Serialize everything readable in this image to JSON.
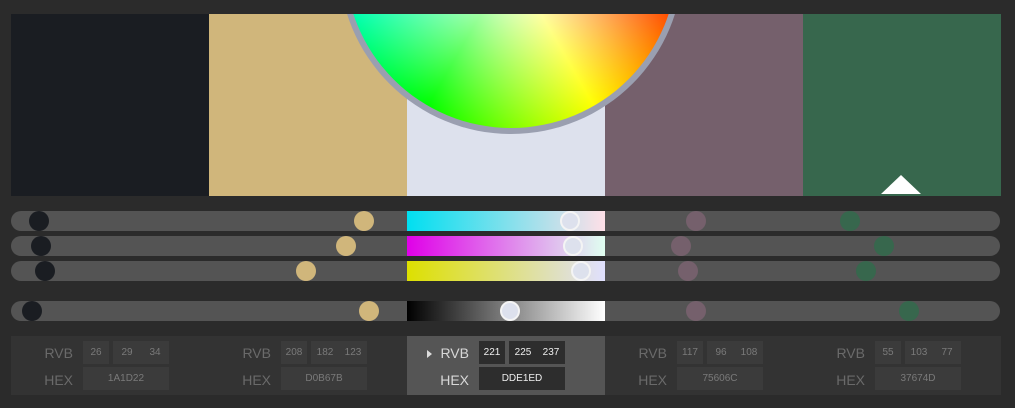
{
  "swatches": [
    {
      "color": "#1A1D22",
      "r": "26",
      "g": "29",
      "b": "34",
      "hex": "1A1D22",
      "knobs": [
        0.028,
        0.03,
        0.034,
        0.021
      ],
      "active": false
    },
    {
      "color": "#D0B67B",
      "r": "208",
      "g": "182",
      "b": "123",
      "hex": "D0B67B",
      "knobs": [
        0.357,
        0.339,
        0.298,
        0.362
      ],
      "active": false
    },
    {
      "color": "#DDE1ED",
      "r": "221",
      "g": "225",
      "b": "237",
      "hex": "DDE1ED",
      "knobs": [
        0.565,
        0.568,
        0.576,
        0.505
      ],
      "active": true
    },
    {
      "color": "#75606C",
      "r": "117",
      "g": "96",
      "b": "108",
      "hex": "75606C",
      "knobs": [
        0.693,
        0.677,
        0.685,
        0.693
      ],
      "active": false
    },
    {
      "color": "#37674D",
      "r": "55",
      "g": "103",
      "b": "77",
      "hex": "37674D",
      "knobs": [
        0.848,
        0.883,
        0.865,
        0.908
      ],
      "active": false
    }
  ],
  "labels": {
    "rgb": "RVB",
    "hex": "HEX"
  },
  "icons": {
    "color_wheel": "color-wheel",
    "selected_marker": "triangle-up-icon",
    "active_indicator": "play-icon"
  },
  "colors": {
    "background": "#2B2B2B",
    "track": "#545454",
    "active_panel": "#555555",
    "panel": "#333333"
  }
}
